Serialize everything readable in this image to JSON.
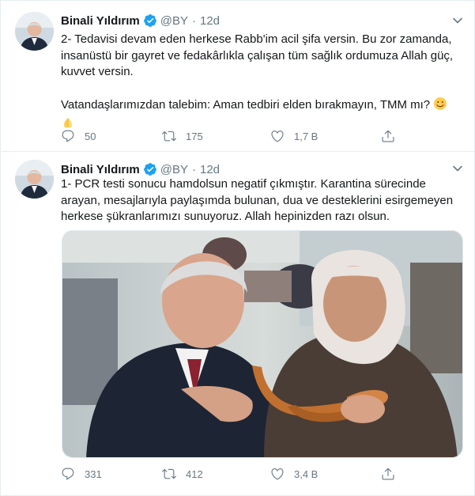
{
  "tweets": [
    {
      "author_name": "Binali Yıldırım",
      "handle": "@BY",
      "separator": "·",
      "time": "12d",
      "paragraph1": "2- Tedavisi devam eden herkese Rabb'im acil şifa versin. Bu zor zamanda, insanüstü bir gayret ve fedakârlıkla çalışan tüm sağlık ordumuza Allah güç, kuvvet versin.",
      "paragraph2": "Vatandaşlarımızdan talebim: Aman tedbiri elden bırakmayın, TMM mı?",
      "emojis": [
        "smiling-face",
        "folded-hands"
      ],
      "replies": "50",
      "retweets": "175",
      "likes": "1,7 B"
    },
    {
      "author_name": "Binali Yıldırım",
      "handle": "@BY",
      "separator": "·",
      "time": "12d",
      "paragraph1": "1- PCR testi sonucu hamdolsun negatif çıkmıştır. Karantina sürecinde arayan, mesajlarıyla paylaşımda bulunan, dua ve desteklerini esirgemeyen herkese şükranlarımızı sunuyoruz. Allah hepinizden razı olsun.",
      "media": "photo",
      "replies": "331",
      "retweets": "412",
      "likes": "3,4 B"
    }
  ],
  "colors": {
    "verified": "#1da1f2",
    "muted": "#657786",
    "text": "#14171a",
    "border": "#e6ecf0"
  },
  "icons": [
    "verified-badge-icon",
    "chevron-down-icon",
    "reply-icon",
    "retweet-icon",
    "like-icon",
    "share-icon"
  ]
}
